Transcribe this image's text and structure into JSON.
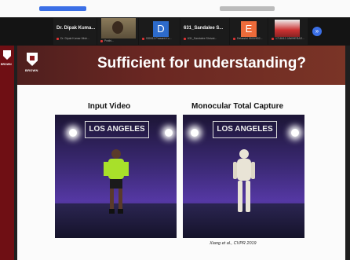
{
  "participants": [
    {
      "name": "Dr. Dipak Kuma...",
      "detail": "Dr. Dipak Kumar Mish..."
    },
    {
      "name": "",
      "detail": "Prathi..."
    },
    {
      "initial": "D",
      "detail": "930911 Prasant Ku..."
    },
    {
      "name": "631_Sandalee S...",
      "detail": "631_Sandalee Shrivat..."
    },
    {
      "initial": "E",
      "detail": "Debashri 5500/902..."
    },
    {
      "name": "",
      "detail": "1718412 JAWHERAS..."
    }
  ],
  "more_button": "»",
  "avatar_colors": {
    "D": "#2d6bcb",
    "E": "#ec6b3a"
  },
  "sidebar_label": "BROWN",
  "slide": {
    "title": "Sufficient for understanding?",
    "university": "BROWN",
    "left_caption": "Input Video",
    "right_caption": "Monocular Total Capture",
    "sign_text": "LOS ANGELES",
    "citation": "Xiang et al., CVPR 2019"
  },
  "brand_color": "#6f0f14"
}
